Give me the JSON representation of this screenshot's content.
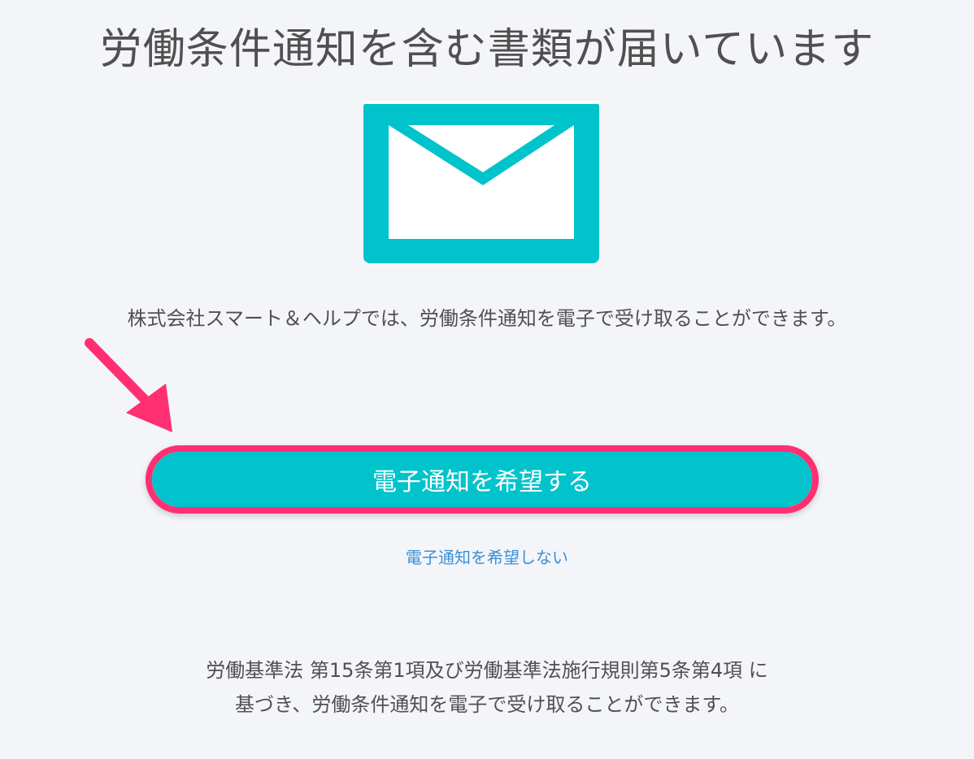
{
  "header": {
    "title": "労働条件通知を含む書類が届いています"
  },
  "icons": {
    "envelope": "envelope-icon",
    "arrow": "pointer-arrow-icon"
  },
  "colors": {
    "accent": "#00c3cb",
    "highlight": "#ff2f72",
    "link": "#3a8fd6",
    "background": "#f4f5f9"
  },
  "intro": {
    "text": "株式会社スマート＆ヘルプでは、労働条件通知を電子で受け取ることができます。"
  },
  "actions": {
    "accept_label": "電子通知を希望する",
    "decline_label": "電子通知を希望しない"
  },
  "legal": {
    "line1": "労働基準法 第15条第1項及び労働基準法施行規則第5条第4項 に",
    "line2": "基づき、労働条件通知を電子で受け取ることができます。"
  }
}
